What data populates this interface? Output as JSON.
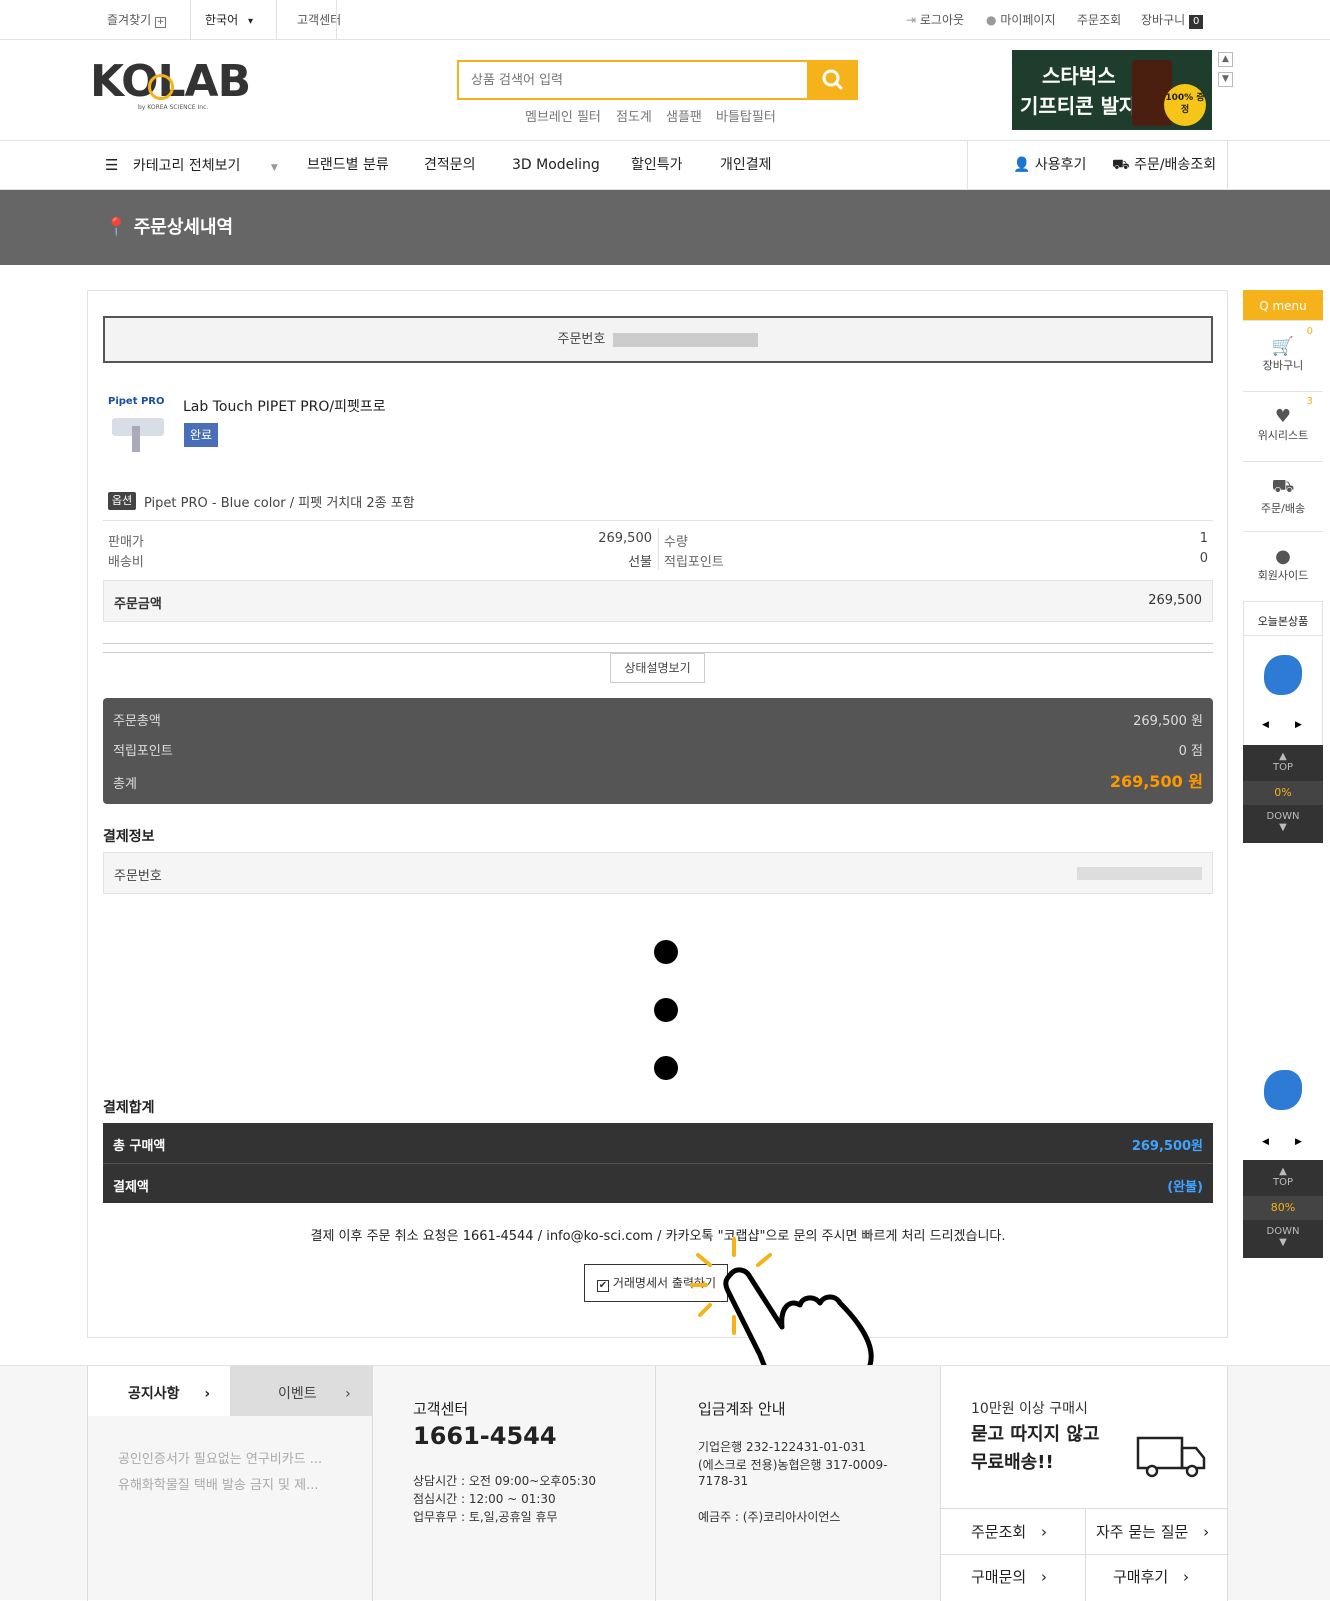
{
  "topbar": {
    "bookmark": "즐겨찾기",
    "language": "한국어",
    "customer_center": "고객센터",
    "logout": "로그아웃",
    "mypage": "마이페이지",
    "order_lookup": "주문조회",
    "cart": "장바구니",
    "cart_count": "0"
  },
  "header": {
    "logo_text": "KOLAB",
    "logo_sub": "by KOREA SCIENCE Inc.",
    "search_placeholder": "상품 검색어 입력",
    "keywords": [
      "멤브레인 필터",
      "점도계",
      "샘플팬",
      "바틀탑필터"
    ],
    "banner_line1": "스타벅스",
    "banner_line2": "기프티콘 발자",
    "banner_badge": "100% 증정"
  },
  "nav": {
    "all_categories": "카테고리 전체보기",
    "items": [
      "브랜드별 분류",
      "견적문의",
      "3D Modeling",
      "할인특가",
      "개인결제"
    ],
    "reviews": "사용후기",
    "order_delivery": "주문/배송조회"
  },
  "page_title": "주문상세내역",
  "order": {
    "order_number_label": "주문번호",
    "product_brand": "Pipet PRO",
    "product_name": "Lab Touch PIPET PRO/피펫프로",
    "status_badge": "완료",
    "option_tag": "옵션",
    "option_text": "Pipet PRO - Blue color / 피펫 거치대 2종 포함",
    "price_label": "판매가",
    "price_value": "269,500",
    "shipping_label": "배송비",
    "shipping_value": "선불",
    "qty_label": "수량",
    "qty_value": "1",
    "points_label": "적립포인트",
    "points_value": "0",
    "amount_label": "주문금액",
    "amount_value": "269,500",
    "status_explain_button": "상태설명보기"
  },
  "summary": {
    "total_label": "주문총액",
    "total_value": "269,500 원",
    "points_label": "적립포인트",
    "points_value": "0 점",
    "grand_label": "총계",
    "grand_value": "269,500 원"
  },
  "payment_info": {
    "heading": "결제정보",
    "order_number_label": "주문번호"
  },
  "payment_total": {
    "heading": "결제합계",
    "purchase_label": "총 구매액",
    "purchase_value": "269,500원",
    "paid_label": "결제액",
    "paid_value": "(완불)"
  },
  "notice_text": "결제 이후 주문 취소 요청은 1661-4544 / info@ko-sci.com / 카카오톡 \"코랩샵\"으로 문의 주시면 빠르게 처리 드리겠습니다.",
  "print_button": "거래명세서 출력하기",
  "qmenu": {
    "title": "Q menu",
    "cart": "장바구니",
    "cart_count": "0",
    "wishlist": "위시리스트",
    "wishlist_count": "3",
    "order_delivery": "주문/배송",
    "member": "회원사이드",
    "recent": "오늘본상품",
    "top": "TOP",
    "down": "DOWN",
    "scroll1": "0%",
    "scroll2": "80%"
  },
  "footer": {
    "tab_notice": "공지사항",
    "tab_event": "이벤트",
    "notices": [
      "공인인증서가 필요없는 연구비카드 ...",
      "유해화학물질 택배 발송 금지 및 제..."
    ],
    "cs_title": "고객센터",
    "cs_phone": "1661-4544",
    "cs_hours": "상담시간 : 오전 09:00~오후05:30",
    "cs_lunch": "점심시간 : 12:00 ~ 01:30",
    "cs_holiday": "업무휴무 : 토,일,공휴일 휴무",
    "bank_title": "입금계좌 안내",
    "bank_line1": "기업은행 232-122431-01-031",
    "bank_line2": "(에스크로 전용)농협은행 317-0009-",
    "bank_line3": "7178-31",
    "bank_holder": "예금주 : (주)코리아사이언스",
    "free_line1": "10만원 이상 구매시",
    "free_line2": "묻고 따지지 않고",
    "free_line3": "무료배송!!",
    "link_order": "주문조회",
    "link_faq": "자주 묻는 질문",
    "link_inquiry": "구매문의",
    "link_review": "구매후기"
  },
  "colors": {
    "accent": "#f5b21a",
    "highlight_orange": "#ff9900",
    "link_blue": "#3fa3ff",
    "title_band": "#666666"
  }
}
